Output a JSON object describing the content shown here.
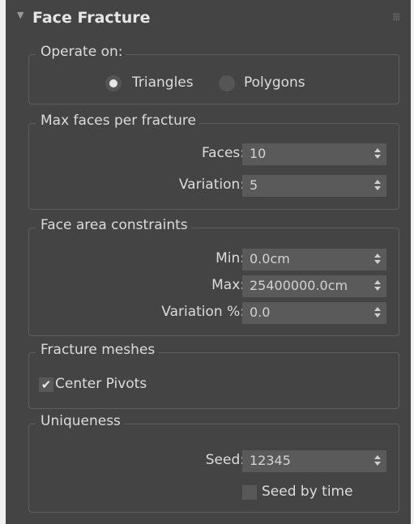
{
  "rollout": {
    "title": "Face Fracture",
    "collapse_icon": "▼"
  },
  "operate_on": {
    "title": "Operate on:",
    "options": [
      {
        "label": "Triangles",
        "checked": true
      },
      {
        "label": "Polygons",
        "checked": false
      }
    ]
  },
  "max_faces": {
    "title": "Max faces per fracture",
    "faces_label": "Faces:",
    "faces_value": "10",
    "variation_label": "Variation:",
    "variation_value": "5"
  },
  "face_area": {
    "title": "Face area constraints",
    "min_label": "Min:",
    "min_value": "0.0cm",
    "max_label": "Max:",
    "max_value": "25400000.0cm",
    "variation_label": "Variation %:",
    "variation_value": "0.0"
  },
  "fracture_meshes": {
    "title": "Fracture meshes",
    "center_pivots_label": "Center Pivots",
    "center_pivots_checked": true,
    "check_glyph": "✔"
  },
  "uniqueness": {
    "title": "Uniqueness",
    "seed_label": "Seed:",
    "seed_value": "12345",
    "seed_by_time_label": "Seed by time",
    "seed_by_time_checked": false
  },
  "colors": {
    "panel_bg": "#444444",
    "field_bg": "#5a5a5a",
    "text": "#dcdcdc"
  }
}
